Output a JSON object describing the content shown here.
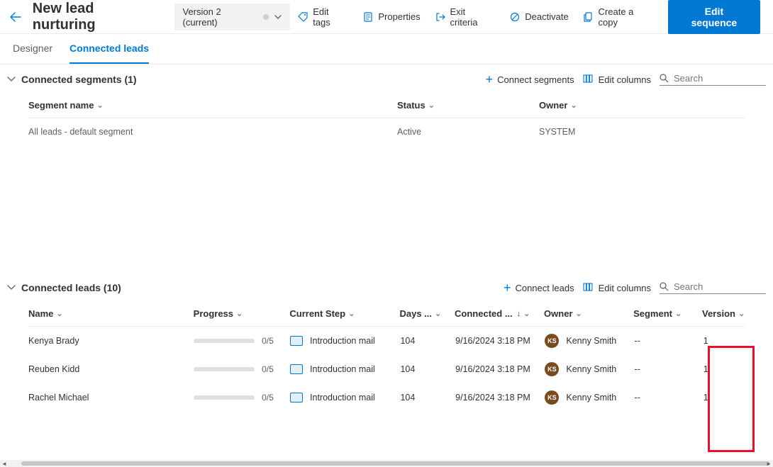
{
  "header": {
    "title": "New lead nurturing",
    "version_label": "Version 2 (current)"
  },
  "toolbar": {
    "edit_tags": "Edit tags",
    "properties": "Properties",
    "exit_criteria": "Exit criteria",
    "deactivate": "Deactivate",
    "create_copy": "Create a copy",
    "edit_sequence": "Edit sequence"
  },
  "tabs": {
    "designer": "Designer",
    "connected_leads": "Connected leads"
  },
  "segments": {
    "title": "Connected segments (1)",
    "connect_label": "Connect segments",
    "edit_columns": "Edit columns",
    "search_placeholder": "Search",
    "columns": {
      "name": "Segment name",
      "status": "Status",
      "owner": "Owner"
    },
    "row": {
      "name": "All leads - default segment",
      "status": "Active",
      "owner": "SYSTEM"
    }
  },
  "leads": {
    "title": "Connected leads (10)",
    "connect_label": "Connect leads",
    "edit_columns": "Edit columns",
    "search_placeholder": "Search",
    "columns": {
      "name": "Name",
      "progress": "Progress",
      "current_step": "Current Step",
      "days": "Days ...",
      "connected": "Connected ...",
      "owner": "Owner",
      "segment": "Segment",
      "version": "Version"
    },
    "rows": [
      {
        "name": "Kenya Brady",
        "progress": "0/5",
        "step": "Introduction mail",
        "days": "104",
        "connected": "9/16/2024 3:18 PM",
        "owner_initials": "KS",
        "owner": "Kenny Smith",
        "segment": "--",
        "version": "1"
      },
      {
        "name": "Reuben Kidd",
        "progress": "0/5",
        "step": "Introduction mail",
        "days": "104",
        "connected": "9/16/2024 3:18 PM",
        "owner_initials": "KS",
        "owner": "Kenny Smith",
        "segment": "--",
        "version": "1"
      },
      {
        "name": "Rachel Michael",
        "progress": "0/5",
        "step": "Introduction mail",
        "days": "104",
        "connected": "9/16/2024 3:18 PM",
        "owner_initials": "KS",
        "owner": "Kenny Smith",
        "segment": "--",
        "version": "1"
      }
    ]
  }
}
